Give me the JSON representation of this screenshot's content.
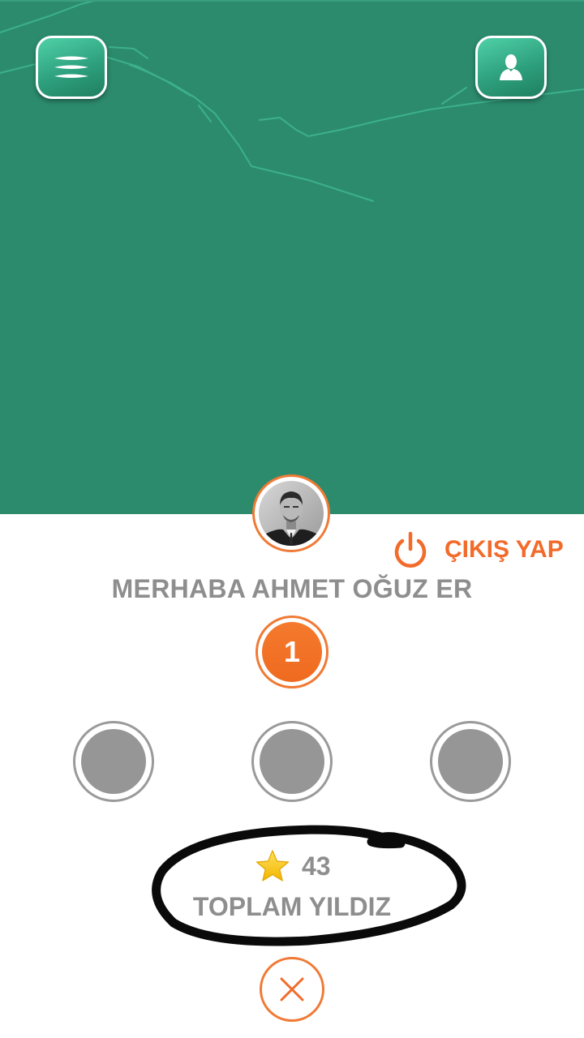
{
  "map": {
    "background_color": "#2c8b6d",
    "road_color": "#4fd1a8"
  },
  "toolbar": {
    "menu_icon": "hamburger-menu-icon",
    "profile_icon": "user-profile-icon"
  },
  "profile": {
    "avatar_icon": "user-avatar-photo",
    "greeting": "MERHABA AHMET OĞUZ ER",
    "logout_label": "ÇIKIŞ YAP",
    "logout_icon": "power-icon",
    "level": "1"
  },
  "badges": {
    "slots": [
      "empty",
      "empty",
      "empty"
    ]
  },
  "stars": {
    "icon": "star-icon",
    "count": "43",
    "label": "TOPLAM YILDIZ"
  },
  "close": {
    "icon": "close-icon"
  },
  "colors": {
    "accent": "#f26b2a",
    "text_gray": "#8e8e8e",
    "badge_gray": "#969696"
  }
}
